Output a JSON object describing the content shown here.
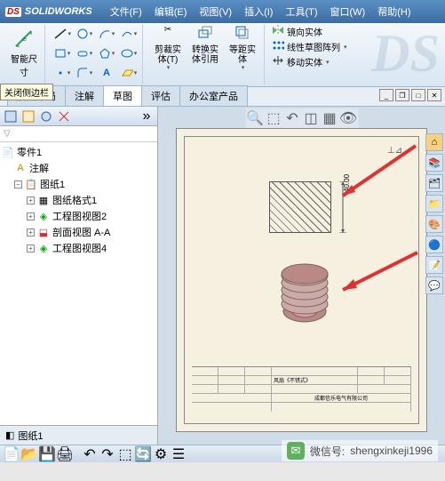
{
  "app": {
    "name": "SOLIDWORKS",
    "logo_ds": "DS"
  },
  "menu": {
    "file": "文件(F)",
    "edit": "编辑(E)",
    "view": "视图(V)",
    "insert": "插入(I)",
    "tools": "工具(T)",
    "window": "窗口(W)",
    "help": "帮助(H)"
  },
  "ribbon": {
    "smart_dim": "智能尺\n寸",
    "trim": "剪裁实\n体(T)",
    "convert": "转换实\n体引用",
    "offset": "等距实\n体",
    "mirror": "镜向实体",
    "linear_pattern": "线性草图阵列",
    "move": "移动实体",
    "tooltip_close": "关闭侧边栏"
  },
  "tabs": {
    "view_layout": "视图布局",
    "annotate": "注解",
    "sketch": "草图",
    "evaluate": "评估",
    "office": "办公室产品"
  },
  "tree": {
    "root": "零件1",
    "annot": "注解",
    "sheet1": "图纸1",
    "sheet_format": "图纸格式1",
    "drw_view2": "工程图视图2",
    "section_aa": "剖面视图 A-A",
    "drw_view4": "工程图视图4"
  },
  "drawing": {
    "dim_value": "40.00",
    "orient_symbol": "⊥⊿",
    "title_company": "成都信乐电气有限公司",
    "title_part": "风扇《不锈式》",
    "sheet_tab": "图纸1"
  },
  "watermark": {
    "label": "微信号:",
    "id": "shengxinkeji1996"
  },
  "colors": {
    "accent": "#3d6ca0",
    "arrow": "#e03030",
    "sheet": "#f5f0e0"
  }
}
